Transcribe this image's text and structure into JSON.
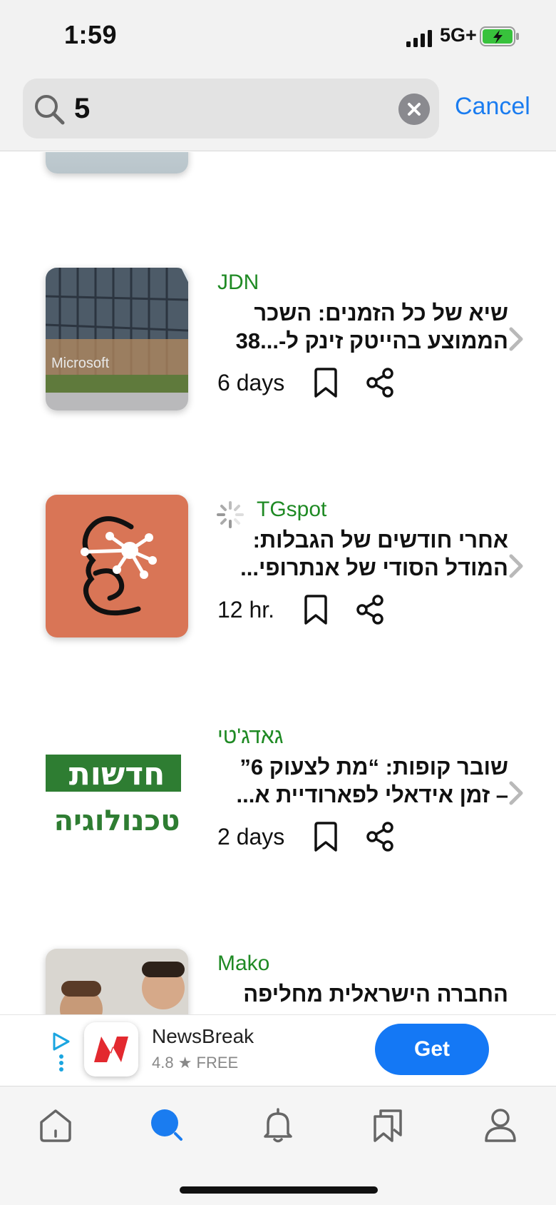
{
  "status_bar": {
    "time": "1:59",
    "network": "5G+"
  },
  "search": {
    "query": "5",
    "cancel_label": "Cancel"
  },
  "feed": {
    "items": [
      {
        "source": "JDN",
        "headline_lines": [
          "שיא של כל הזמנים: השכר",
          "הממוצע בהייטק זינק ל-...38"
        ],
        "time": "6 days"
      },
      {
        "source": "TGspot",
        "headline_lines": [
          "אחרי חודשים של הגבלות:",
          "המודל הסודי של אנתרופי..."
        ],
        "time": "12 hr."
      },
      {
        "source": "גאדג'טי",
        "headline_lines": [
          "שובר קופות: “מת לצעוק 6”",
          "– זמן אידאלי לפארודיית א..."
        ],
        "time": "2 days"
      },
      {
        "source": "Mako",
        "headline_lines": [
          "החברה הישראלית מחליפה"
        ],
        "time": ""
      }
    ]
  },
  "ad": {
    "app_name": "NewsBreak",
    "rating": "4.8 ★  FREE",
    "cta_label": "Get"
  },
  "tab_bar": {
    "tabs": [
      "home-icon",
      "search-icon",
      "bell-icon",
      "bookmarks-icon",
      "profile-icon"
    ],
    "active_color": "#1a7cf0"
  },
  "colors": {
    "accent": "#1a7cf0",
    "source_green": "#1f8a24",
    "tgspot_tile": "#d97556"
  }
}
